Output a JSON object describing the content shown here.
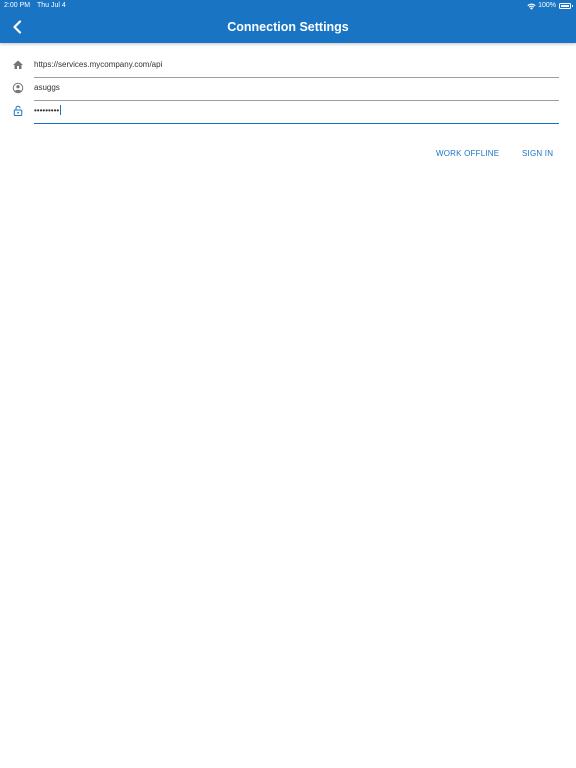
{
  "status_bar": {
    "time": "2:00 PM",
    "date": "Thu Jul 4",
    "battery": "100%",
    "icons": [
      "wifi-icon",
      "battery-icon"
    ]
  },
  "header": {
    "title": "Connection Settings",
    "back_icon": "chevron-left-icon",
    "background_color": "#1a74c4"
  },
  "form": {
    "server_url": {
      "icon": "home-icon",
      "value": "https://services.mycompany.com/api"
    },
    "username": {
      "icon": "account-circle-icon",
      "value": "asuggs"
    },
    "password": {
      "icon": "lock-open-icon",
      "value": "•••••••••"
    }
  },
  "actions": {
    "work_offline": "WORK OFFLINE",
    "sign_in": "SIGN IN"
  },
  "colors": {
    "accent": "#1a74c4",
    "field_border": "#9e9e9e",
    "icon_gray": "#757575"
  }
}
